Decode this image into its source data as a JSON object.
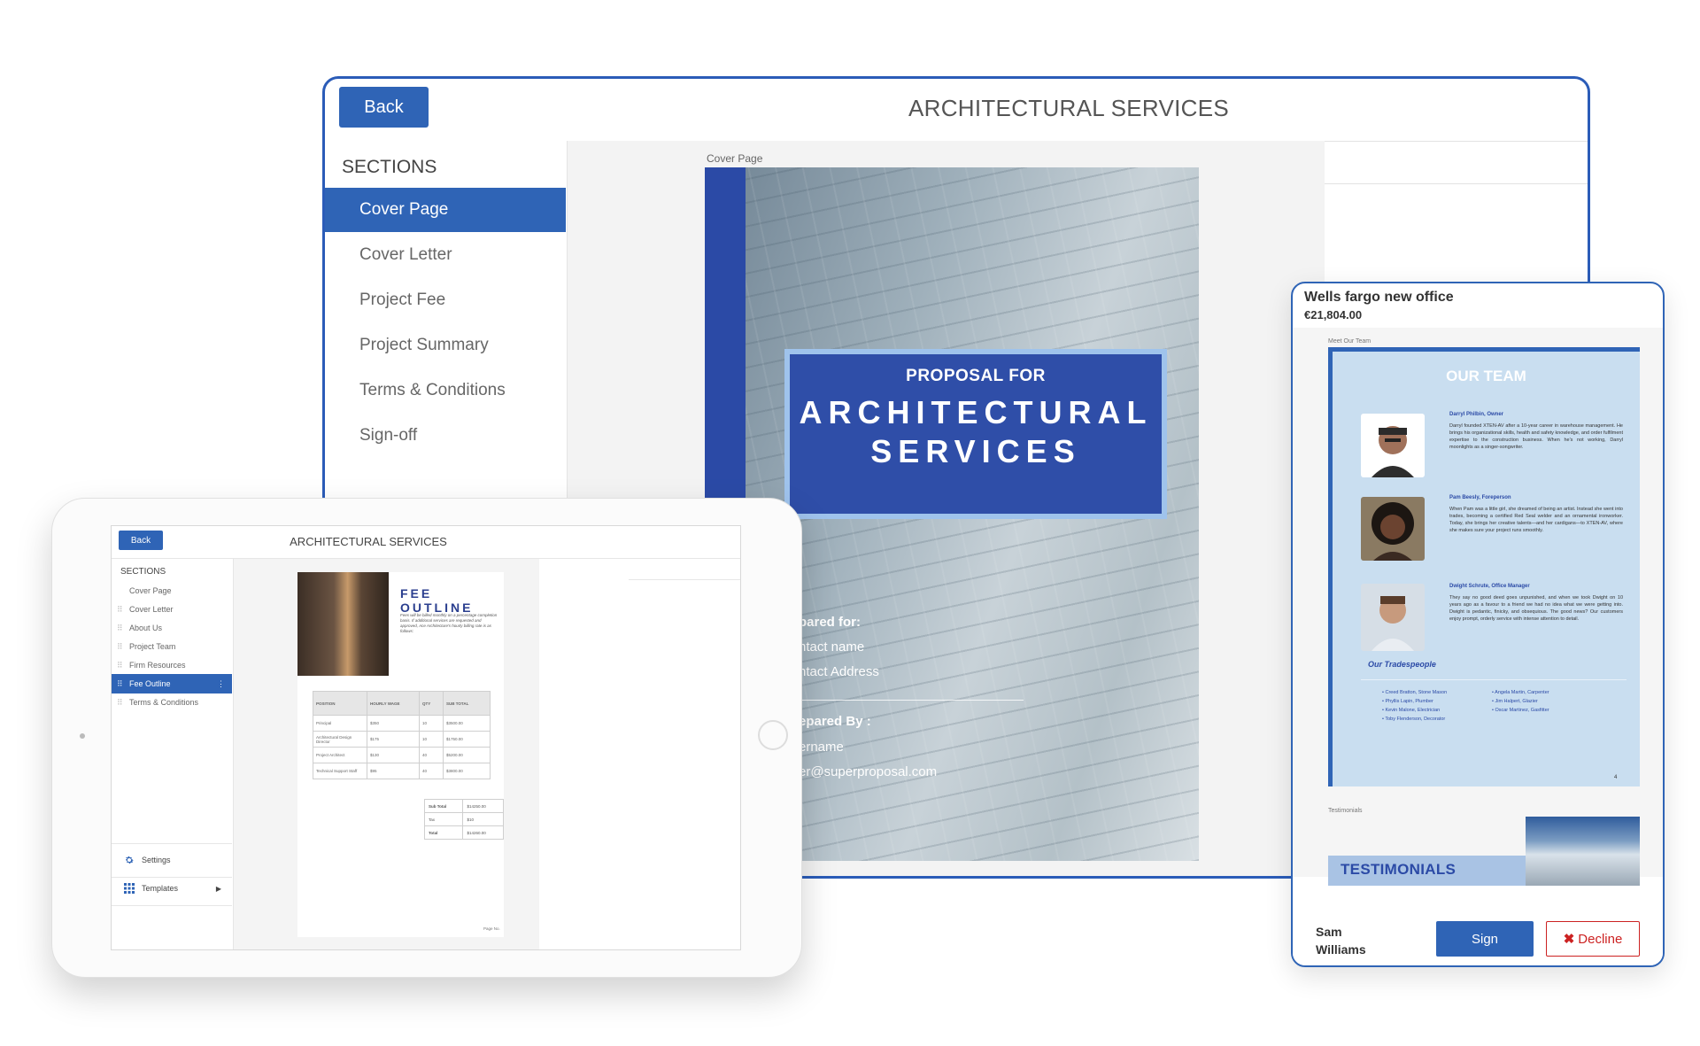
{
  "main": {
    "back_label": "Back",
    "title": "ARCHITECTURAL SERVICES",
    "sections_heading": "SECTIONS",
    "sections": [
      "Cover Page",
      "Cover Letter",
      "Project Fee",
      "Project Summary",
      "Terms & Conditions",
      "Sign-off"
    ],
    "active_section": "Cover Page",
    "cover_label": "Cover Page",
    "cover": {
      "proposal_for": "PROPOSAL FOR",
      "title_line1": "ARCHITECTURAL",
      "title_line2": "SERVICES",
      "prepared_for": "pared for:",
      "contact_name": "ntact name",
      "contact_address": "ntact Address",
      "prepared_by": "epared By :",
      "username": "ername",
      "email": "er@superproposal.com"
    }
  },
  "tablet": {
    "back_label": "Back",
    "title": "ARCHITECTURAL SERVICES",
    "sections_heading": "SECTIONS",
    "sections": [
      "Cover Page",
      "Cover Letter",
      "About Us",
      "Project Team",
      "Firm Resources",
      "Fee Outline",
      "Terms & Conditions"
    ],
    "active_section": "Fee Outline",
    "settings_label": "Settings",
    "templates_label": "Templates",
    "fee": {
      "title": "FEE OUTLINE",
      "desc": "Fees will be billed monthly on a percentage completion basis. If additional services are requested and approved, Ace Architecture's hourly billing rate is as follows:",
      "headers": [
        "POSITION",
        "HOURLY WAGE",
        "QTY",
        "SUB TOTAL"
      ],
      "rows": [
        [
          "Principal",
          "$350",
          "10",
          "$3500.00"
        ],
        [
          "Architectural Design Director",
          "$175",
          "10",
          "$1750.00"
        ],
        [
          "Project Architect",
          "$130",
          "40",
          "$5200.00"
        ],
        [
          "Technical Support Staff",
          "$95",
          "40",
          "$3800.00"
        ]
      ],
      "totals": [
        [
          "Sub Total",
          "$14250.00"
        ],
        [
          "Tax",
          "$10"
        ],
        [
          "Total",
          "$14260.00"
        ]
      ],
      "page_no": "Page No."
    }
  },
  "phone": {
    "project_name": "Wells fargo new office",
    "amount": "€21,804.00",
    "meet_team_label": "Meet Our Team",
    "team_heading": "OUR TEAM",
    "people": [
      {
        "name": "Darryl Philbin, Owner",
        "bio": "Darryl founded XTEN-AV after a 10-year career in warehouse management. He brings his organizational skills, health and safety knowledge, and order fulfilment expertise to the construction business. When he's not working, Darryl moonlights as a singer-songwriter."
      },
      {
        "name": "Pam Beesly, Foreperson",
        "bio": "When Pam was a little girl, she dreamed of being an artist. Instead she went into trades, becoming a certified Red Seal welder and an ornamental ironworker. Today, she brings her creative talents—and her cardigans—to XTEN-AV, where she makes sure your project runs smoothly."
      },
      {
        "name": "Dwight Schrute, Office Manager",
        "bio": "They say no good deed goes unpunished, and when we took Dwight on 10 years ago as a favour to a friend we had no idea what we were getting into. Dwight is pedantic, finicky, and obsequious. The good news? Our customers enjoy prompt, orderly service with intense attention to detail."
      }
    ],
    "tradespeople_heading": "Our Tradespeople",
    "trades_left": [
      "Creed Bratton, Stone Mason",
      "Phyllis Lapin, Plumber",
      "Kevin Malone, Electrician",
      "Toby Flenderson, Decorator"
    ],
    "trades_right": [
      "Angela Martin, Carpenter",
      "Jim Halpert, Glazier",
      "Oscar Martinez, Gasfitter"
    ],
    "page_number": "4",
    "testimonials_label": "Testimonials",
    "testimonials_heading": "TESTIMONIALS",
    "signer": "Sam Williams",
    "sign_label": "Sign",
    "decline_label": "Decline"
  },
  "colors": {
    "accent": "#2f64b6",
    "cover_blue": "#2f4ea8",
    "decline_red": "#cc2222"
  }
}
